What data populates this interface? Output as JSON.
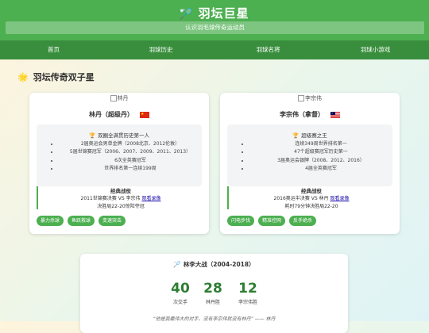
{
  "header": {
    "title": "羽坛巨星",
    "tagline": "认识羽毛球传奇运动员"
  },
  "nav": {
    "items": [
      "首页",
      "羽球历史",
      "羽球名将",
      "羽球小游戏"
    ]
  },
  "section": {
    "title": "羽坛传奇双子星"
  },
  "players": [
    {
      "photo_alt": "林丹",
      "name": "林丹（超级丹）",
      "honor_title": "双圈全满贯历史第一人",
      "honors": [
        "2届奥运会男单金牌（2008北京、2012伦敦）",
        "5届世锦赛冠军（2006、2007、2009、2011、2013）",
        "6次全英赛冠军",
        "世界排名第一连续199周"
      ],
      "battle_title": "经典战役",
      "battle_match": "2011世锦赛决赛 VS 李宗伟",
      "battle_link": "观看录像",
      "battle_detail": "决胜局22-20惊险夺冠",
      "tags": [
        "暴力杀球",
        "鱼跃救球",
        "变速突击"
      ]
    },
    {
      "photo_alt": "李宗伟",
      "name": "李宗伟（拿督）",
      "honor_title": "超级赛之王",
      "honors": [
        "连续349周世界排名第一",
        "47个超级赛冠军历史第一",
        "3届奥运会银牌（2008、2012、2016）",
        "4届全英赛冠军"
      ],
      "battle_title": "经典战役",
      "battle_match": "2016奥运半决赛 VS 林丹",
      "battle_link": "观看录像",
      "battle_detail": "耗时79分钟决胜局22-20",
      "tags": [
        "闪电步伐",
        "精准控网",
        "反手绝杀"
      ]
    }
  ],
  "rivalry": {
    "title": "林李大战（2004-2018）",
    "stats": [
      {
        "value": "40",
        "label": "次交手"
      },
      {
        "value": "28",
        "label": "林丹胜"
      },
      {
        "value": "12",
        "label": "李宗伟胜"
      }
    ],
    "quote": "“他是我最伟大的对手，没有李宗伟就没有林丹” —— 林丹"
  },
  "colors": {
    "primary": "#4caf50",
    "nav": "#388e3c",
    "stat": "#2e7d32",
    "link": "#1a0dab"
  },
  "icons": {
    "brand": "badminton-racket-icon",
    "section": "star-icon",
    "honor": "trophy-icon",
    "rivalry": "racket-icon",
    "flags": [
      "china-flag-icon",
      "malaysia-flag-icon"
    ]
  }
}
